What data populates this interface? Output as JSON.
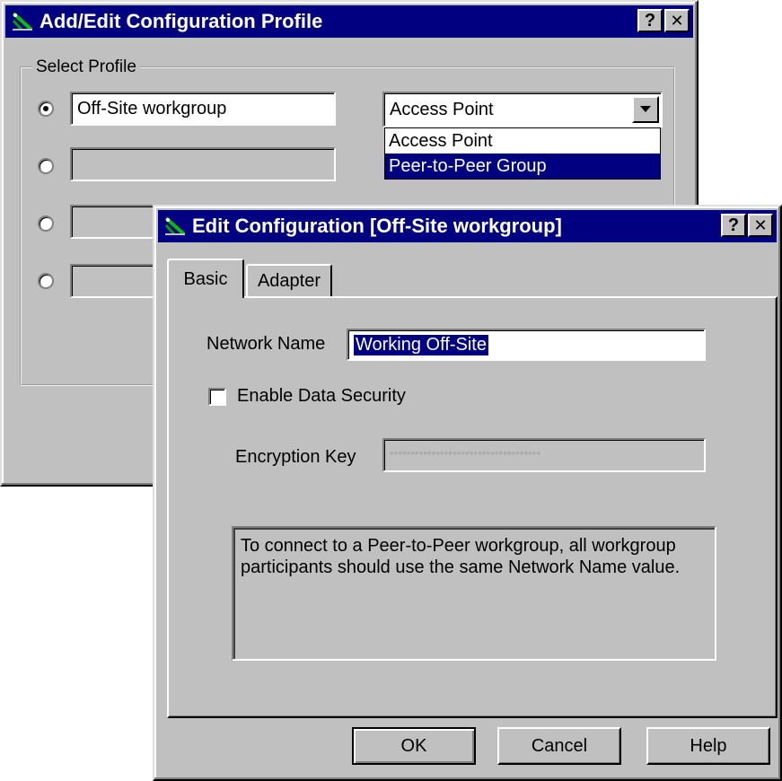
{
  "back_dialog": {
    "title": "Add/Edit Configuration Profile",
    "help_label": "?",
    "close_label": "✕",
    "group_label": "Select Profile",
    "profiles": [
      {
        "name": "Off-Site workgroup",
        "selected": true
      },
      {
        "name": "",
        "selected": false
      },
      {
        "name": "",
        "selected": false
      },
      {
        "name": "",
        "selected": false
      }
    ],
    "mode_select": {
      "value": "Access Point",
      "options": [
        "Access Point",
        "Peer-to-Peer Group"
      ],
      "highlighted_option": "Peer-to-Peer Group"
    }
  },
  "front_dialog": {
    "title": "Edit Configuration [Off-Site workgroup]",
    "help_label": "?",
    "close_label": "✕",
    "tabs": [
      {
        "label": "Basic",
        "active": true
      },
      {
        "label": "Adapter",
        "active": false
      }
    ],
    "network_name_label": "Network Name",
    "network_name_value": "Working Off-Site",
    "enable_security_label": "Enable Data Security",
    "enable_security_checked": false,
    "encryption_key_label": "Encryption Key",
    "encryption_key_value": "************************************",
    "info_text": "To connect to a Peer-to-Peer workgroup, all workgroup participants should use the same Network Name value.",
    "buttons": {
      "ok": "OK",
      "cancel": "Cancel",
      "help": "Help"
    }
  },
  "colors": {
    "title_bar": "#000080",
    "face": "#c0c0c0",
    "selection": "#000080"
  },
  "icons": {
    "app": "network-signal-icon",
    "dropdown": "chevron-down-icon"
  }
}
